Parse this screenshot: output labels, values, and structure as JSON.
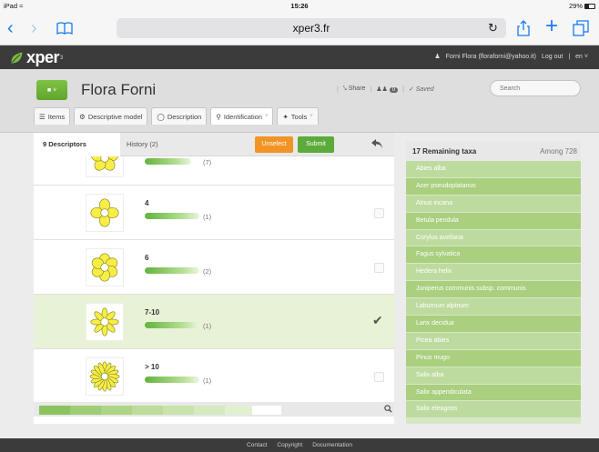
{
  "statusbar": {
    "device": "iPad",
    "time": "15:26",
    "battery": "29%"
  },
  "browser": {
    "url": "xper3.fr"
  },
  "app": {
    "logo": "xper",
    "logo_sup": "3",
    "user": "Forni Flora (floraforni@yahoo.it)",
    "logout": "Log out",
    "sep": "|",
    "lang": "en"
  },
  "project": {
    "title": "Flora Forni",
    "share": "Share",
    "users_count": "0",
    "saved": "Saved",
    "search_placeholder": "Search"
  },
  "tabs": [
    {
      "label": "Items"
    },
    {
      "label": "Descriptive model"
    },
    {
      "label": "Description"
    },
    {
      "label": "Identification"
    },
    {
      "label": "Tools"
    }
  ],
  "panel": {
    "descriptors_tab": "9 Descriptors",
    "history_tab": "History (2)",
    "unselect": "Unselect",
    "submit": "Submit"
  },
  "states": [
    {
      "label": "",
      "count": "(7)",
      "fill": 0.85,
      "petals": 5,
      "selected": false
    },
    {
      "label": "4",
      "count": "(1)",
      "fill": 1.0,
      "petals": 4,
      "selected": false
    },
    {
      "label": "6",
      "count": "(2)",
      "fill": 1.0,
      "petals": 6,
      "selected": false
    },
    {
      "label": "7-10",
      "count": "(1)",
      "fill": 1.0,
      "petals": 8,
      "selected": true
    },
    {
      "label": "> 10",
      "count": "(1)",
      "fill": 1.0,
      "petals": 16,
      "selected": false
    }
  ],
  "remaining": {
    "title": "17 Remaining taxa",
    "among": "Among 728",
    "taxa": [
      "Abies alba",
      "Acer pseudoplatanus",
      "Alnus incana",
      "Betula pendula",
      "Corylus avellana",
      "Fagus sylvatica",
      "Hedera helix",
      "Juniperus communis subsp. communis",
      "Laburnum alpinum",
      "Larix decidua",
      "Picea abies",
      "Pinus mugo",
      "Salix alba",
      "Salix appendiculata",
      "Salix eleagnos"
    ]
  },
  "footer": {
    "contact": "Contact",
    "copyright": "Copyright",
    "documentation": "Documentation"
  },
  "colors": {
    "accent": "#1a7bf0",
    "green": "#5cab3a",
    "orange": "#f29425",
    "header": "#3b3b3b"
  }
}
